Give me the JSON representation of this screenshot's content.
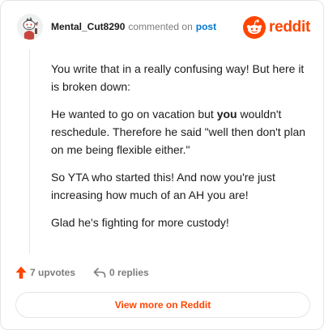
{
  "header": {
    "username": "Mental_Cut8290",
    "verb": "commented on",
    "post_link": "post",
    "brand": "reddit"
  },
  "comment": {
    "p1": "You write that in a really confusing way! But here it is broken down:",
    "p2_before": "He wanted to go on vacation but ",
    "p2_bold": "you",
    "p2_after": " wouldn't reschedule. Therefore he said \"well then don't plan on me being flexible either.\"",
    "p3": "So YTA who started this! And now you're just increasing how much of an AH you are!",
    "p4": "Glad he's fighting for more custody!"
  },
  "actions": {
    "upvotes": "7 upvotes",
    "replies": "0 replies"
  },
  "footer": {
    "view_more": "View more on Reddit"
  },
  "colors": {
    "brand": "#ff4500",
    "link": "#0079d3",
    "muted": "#7c7c7c"
  },
  "icons": {
    "avatar": "snoo-avatar",
    "logo": "reddit-snoo-icon",
    "upvote": "upvote-arrow-icon",
    "reply": "reply-arrow-icon"
  }
}
